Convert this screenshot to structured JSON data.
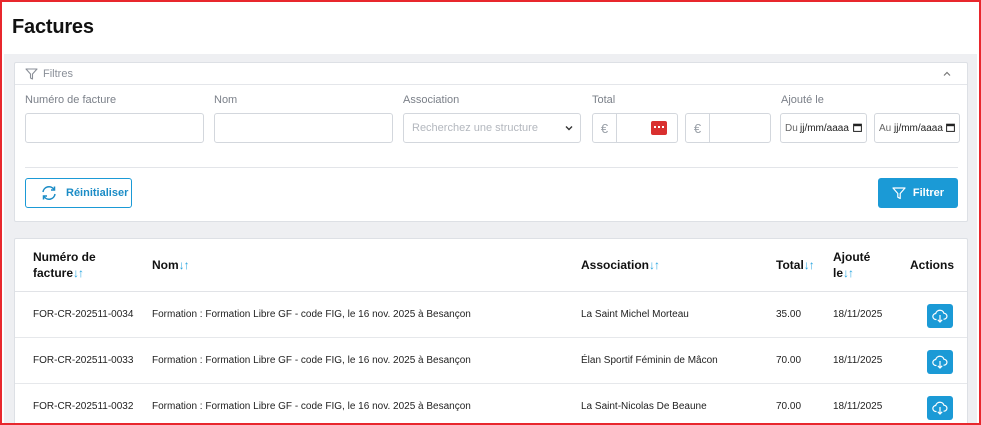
{
  "page": {
    "title": "Factures"
  },
  "filters": {
    "header_label": "Filtres",
    "fields": {
      "invoice_number_label": "Numéro de facture",
      "name_label": "Nom",
      "association_label": "Association",
      "association_placeholder": "Recherchez une structure",
      "total_label": "Total",
      "currency_symbol": "€",
      "added_label": "Ajouté le",
      "date_from_prefix": "Du",
      "date_to_prefix": "Au",
      "date_placeholder": "jj/mm/aaaa"
    },
    "reset_label": "Réinitialiser",
    "filter_label": "Filtrer"
  },
  "table": {
    "columns": {
      "invoice_number": "Numéro de facture",
      "name": "Nom",
      "association": "Association",
      "total": "Total",
      "added": "Ajouté le",
      "actions": "Actions"
    },
    "sort_glyph": "↓↑",
    "rows": [
      {
        "invoice": "FOR-CR-202511-0034",
        "name": "Formation : Formation Libre GF - code FIG, le 16 nov. 2025 à Besançon",
        "association": "La Saint Michel Morteau",
        "total": "35.00",
        "date": "18/11/2025"
      },
      {
        "invoice": "FOR-CR-202511-0033",
        "name": "Formation : Formation Libre GF - code FIG, le 16 nov. 2025 à Besançon",
        "association": "Élan Sportif Féminin de Mâcon",
        "total": "70.00",
        "date": "18/11/2025"
      },
      {
        "invoice": "FOR-CR-202511-0032",
        "name": "Formation : Formation Libre GF - code FIG, le 16 nov. 2025 à Besançon",
        "association": "La Saint-Nicolas De Beaune",
        "total": "70.00",
        "date": "18/11/2025"
      }
    ]
  },
  "colors": {
    "accent": "#1b9ad6",
    "frame": "#e8272d",
    "background": "#eeeff2"
  },
  "icons": [
    "filter-icon",
    "chevron-up-icon",
    "chevron-down-icon",
    "calendar-icon",
    "refresh-icon",
    "cloud-download-icon"
  ]
}
